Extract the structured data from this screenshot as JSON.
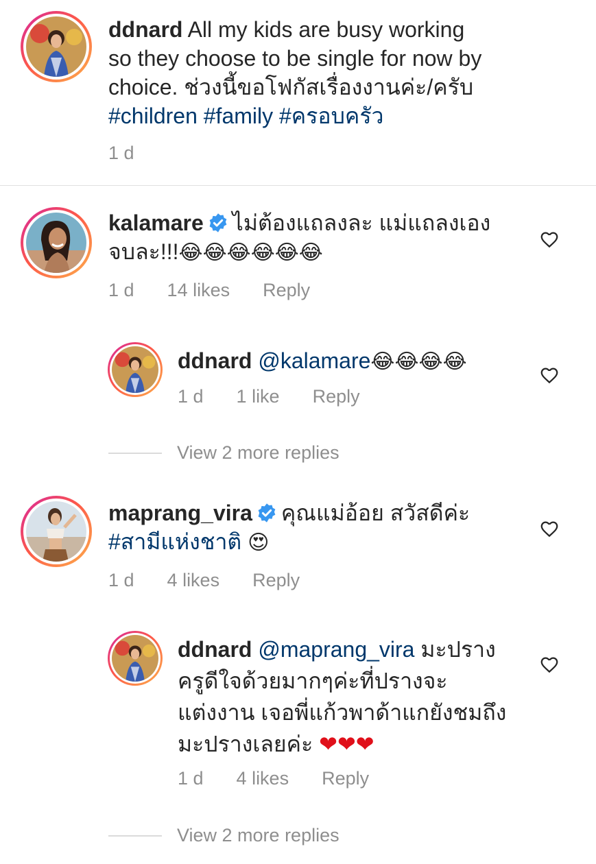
{
  "caption": {
    "username": "ddnard",
    "text_line1": "All my kids are busy working",
    "text_line2": "so they choose to be single for now by",
    "text_line3": "choice. ช่วงนี้ขอโฟกัสเรื่องงานค่ะ/ครับ",
    "hashtags": "#children #family #ครอบครัว",
    "time": "1 d"
  },
  "comments": [
    {
      "username": "kalamare",
      "verified": true,
      "text_line1": "ไม่ต้องแถลงละ แม่แถลงเอง",
      "text_line2": "จบละ!!!",
      "emojis": "😂😂😂😂😂😂",
      "time": "1 d",
      "likes": "14 likes",
      "reply_label": "Reply",
      "replies": [
        {
          "username": "ddnard",
          "mention": "@kalamare",
          "emojis": "😂😂😂😂",
          "time": "1 d",
          "likes": "1 like",
          "reply_label": "Reply"
        }
      ],
      "view_more": "View 2 more replies"
    },
    {
      "username": "maprang_vira",
      "verified": true,
      "text_line1": "คุณแม่อ้อย สวัสดีค่ะ",
      "hashtag": "#สามีแห่งชาติ",
      "emoji": "😍",
      "time": "1 d",
      "likes": "4 likes",
      "reply_label": "Reply",
      "replies": [
        {
          "username": "ddnard",
          "mention": "@maprang_vira",
          "text_line1": "มะปราง",
          "text_line2": "ครูดีใจด้วยมากๆค่ะที่ปรางจะ",
          "text_line3": "แต่งงาน เจอพี่แก้วพาด้าแกยังชมถึง",
          "text_line4": "มะปรางเลยค่ะ",
          "hearts": "❤❤❤",
          "time": "1 d",
          "likes": "4 likes",
          "reply_label": "Reply"
        }
      ],
      "view_more": "View 2 more replies"
    }
  ],
  "colors": {
    "text": "#262626",
    "secondary": "#8e8e8e",
    "link": "#00376b",
    "verified": "#3897f0"
  },
  "icons": [
    "verified-badge-icon",
    "heart-outline-icon"
  ]
}
